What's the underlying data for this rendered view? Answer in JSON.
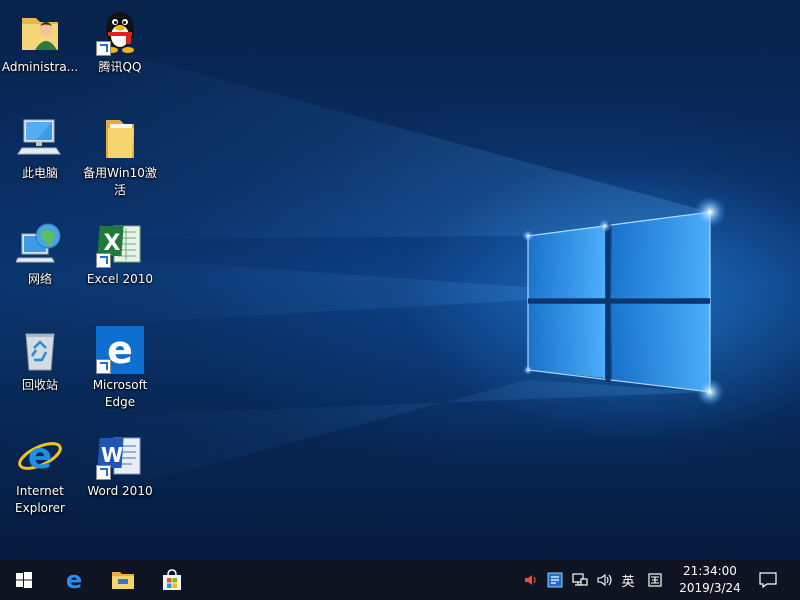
{
  "desktop": {
    "icons": [
      {
        "label": "Administra..."
      },
      {
        "label": "腾讯QQ"
      },
      {
        "label": "此电脑"
      },
      {
        "label": "备用Win10激活"
      },
      {
        "label": "网络"
      },
      {
        "label": "Excel 2010"
      },
      {
        "label": "回收站"
      },
      {
        "label": "Microsoft Edge"
      },
      {
        "label": "Internet Explorer"
      },
      {
        "label": "Word 2010"
      }
    ]
  },
  "taskbar": {
    "pinned": [
      "start-icon",
      "edge-icon",
      "file-explorer-icon",
      "store-icon"
    ],
    "tray": {
      "ime_lang": "英",
      "ime_mode": "囯"
    },
    "clock": {
      "time": "21:34:00",
      "date": "2019/3/24"
    }
  },
  "colors": {
    "wallpaper_dark": "#041a3a",
    "wallpaper_glow": "#3fa3ff",
    "taskbar": "#0e1421"
  }
}
